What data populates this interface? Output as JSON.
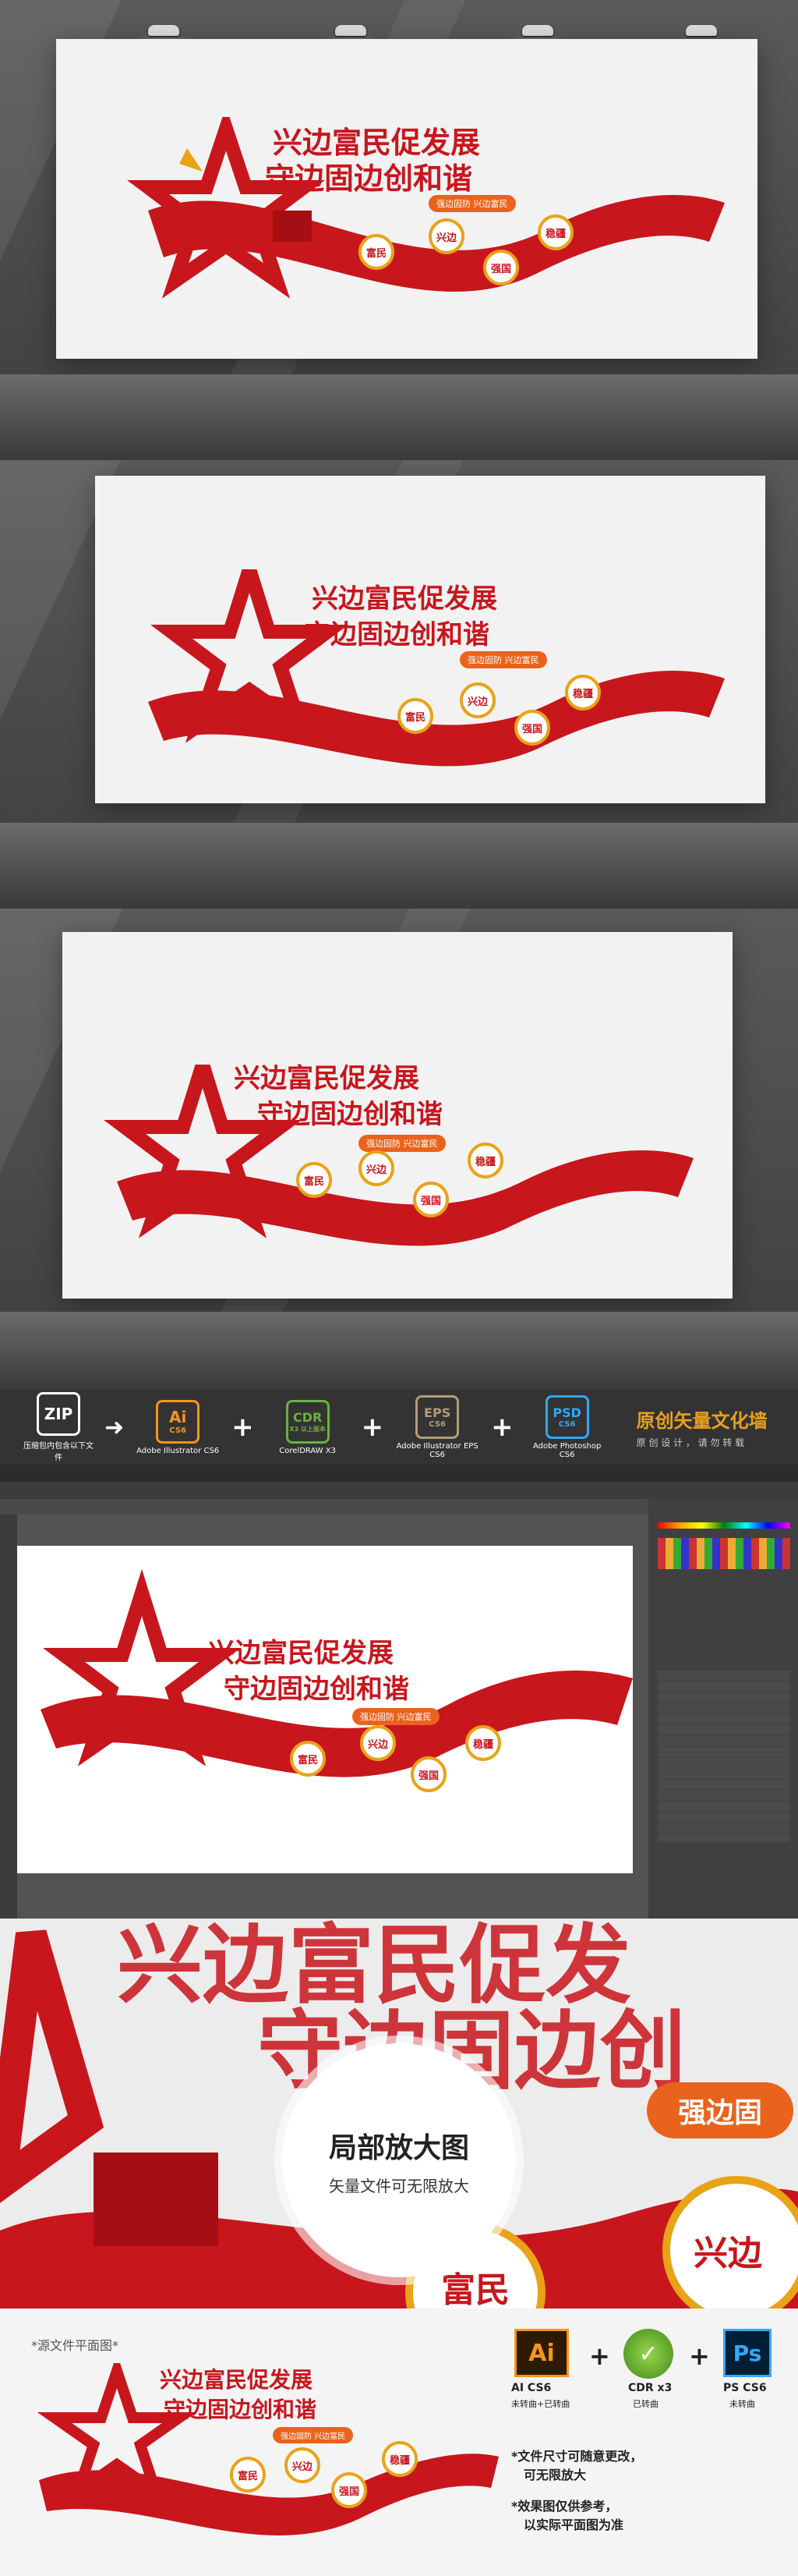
{
  "design": {
    "title_line1": "兴边富民促发展",
    "title_line2": "守边固边创和谐",
    "tagline": "强边固防 兴边富民",
    "badges": [
      "富民",
      "兴边",
      "强国",
      "稳疆"
    ]
  },
  "format_bar": {
    "zip": {
      "label": "ZIP",
      "sub": "压缩包",
      "note": "压缩包内包含以下文件"
    },
    "ai": {
      "label": "Ai",
      "version": "CS6",
      "app": "Adobe Illustrator CS6"
    },
    "cdr": {
      "label": "CDR",
      "version": "X3",
      "sub": "X3 以上版本",
      "app": "CorelDRAW X3"
    },
    "eps": {
      "label": "EPS",
      "version": "CS6",
      "app": "Adobe Illustrator EPS CS6"
    },
    "psd": {
      "label": "PSD",
      "version": "CS6",
      "app": "Adobe Photoshop CS6"
    },
    "brand_title": "原创矢量文化墙",
    "brand_sub": "原 创 设 计 ， 请 勿 转 载"
  },
  "zoom": {
    "title": "局部放大图",
    "sub": "矢量文件可无限放大",
    "bg_line1": "兴边富民促发",
    "bg_line2": "守边固边创",
    "bg_pill": "强边固",
    "bg_badge1": "富民",
    "bg_badge2": "兴边"
  },
  "source": {
    "label": "*源文件平面图*",
    "ai_label": "Ai",
    "ai_caption": "AI CS6",
    "ai_caption2": "未转曲+已转曲",
    "cdr_caption": "CDR x3",
    "cdr_caption2": "已转曲",
    "ps_label": "Ps",
    "ps_caption": "PS CS6",
    "ps_caption2": "未转曲",
    "note1a": "*文件尺寸可随意更改，",
    "note1b": "可无限放大",
    "note2a": "*效果图仅供参考，",
    "note2b": "以实际平面图为准"
  },
  "colors": {
    "red": "#c8161d",
    "gold": "#e8a317",
    "orange": "#e9631c"
  }
}
